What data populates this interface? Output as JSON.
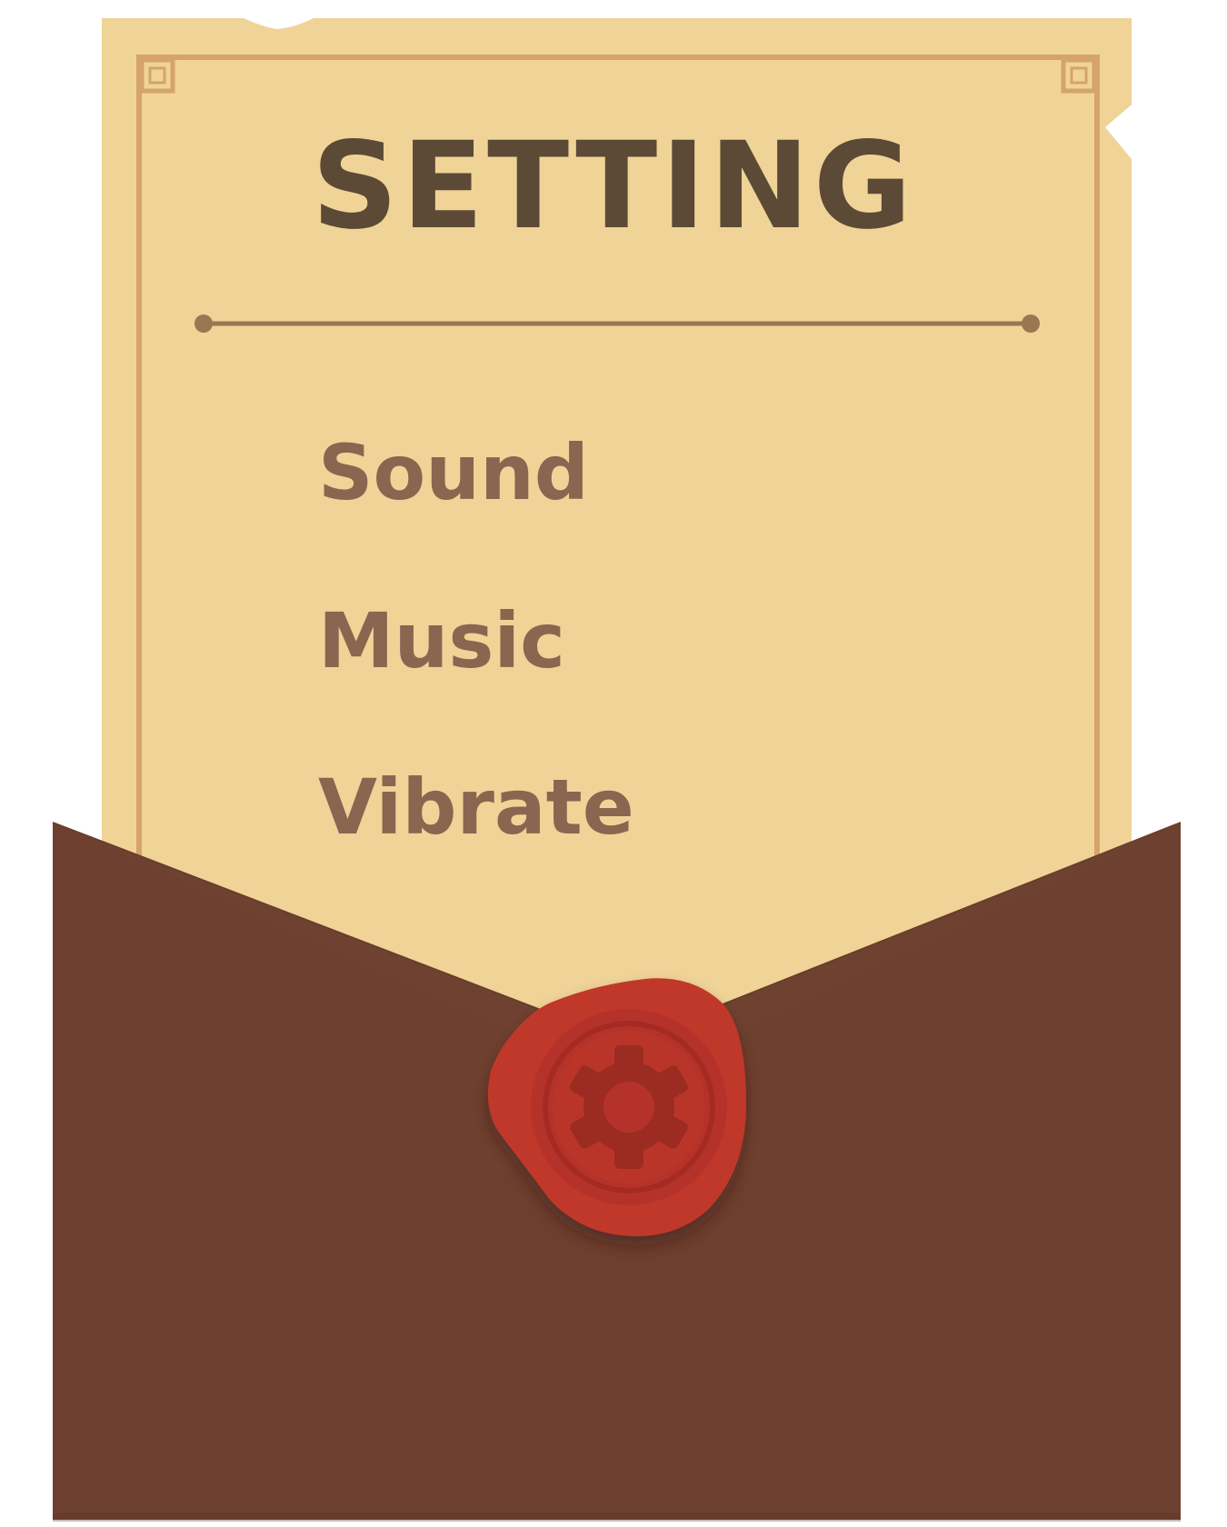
{
  "title": "SETTING",
  "menu": {
    "items": [
      {
        "label": "Sound"
      },
      {
        "label": "Music"
      },
      {
        "label": "Vibrate"
      }
    ]
  },
  "seal": {
    "icon": "gear-icon"
  },
  "colors": {
    "paper": "#f0d397",
    "paper_border": "#d4a46c",
    "title_text": "#5c4a36",
    "item_text": "#8a6550",
    "divider": "#9b7652",
    "envelope": "#6f4130",
    "seal": "#c0392b"
  }
}
